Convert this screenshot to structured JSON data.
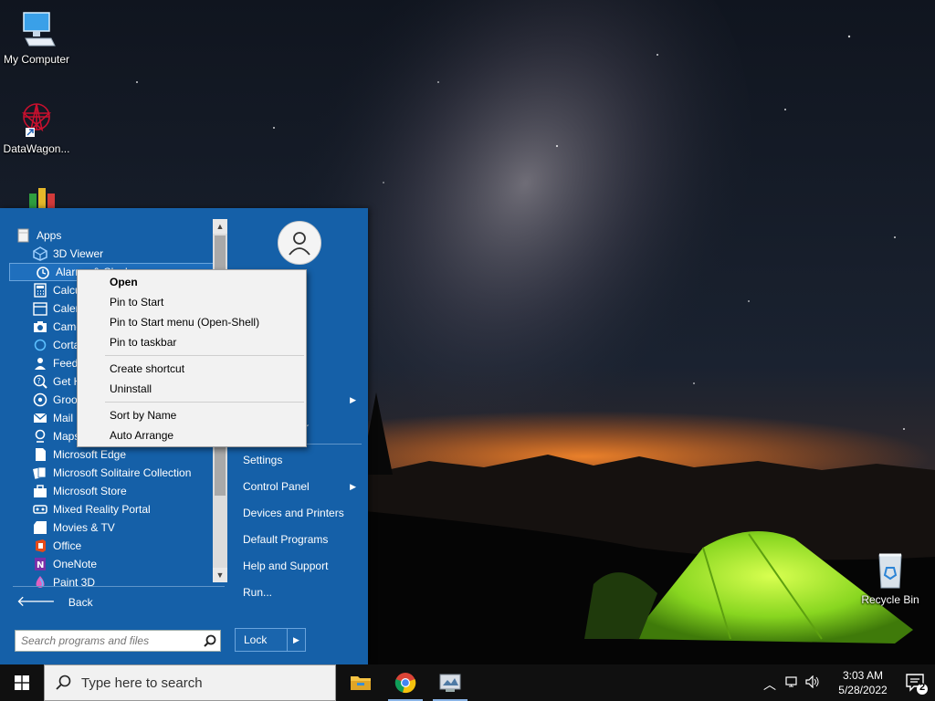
{
  "desktop": {
    "icons": [
      {
        "label": "My Computer"
      },
      {
        "label": "DataWagon..."
      },
      {
        "label": "Recycle Bin"
      }
    ]
  },
  "start_menu": {
    "folder": "Apps",
    "programs": [
      "3D Viewer",
      "Alarms & Clock",
      "Calculator",
      "Calendar",
      "Camera",
      "Cortana",
      "Feedback Hub",
      "Get Help",
      "Groove Music",
      "Mail",
      "Maps",
      "Microsoft Edge",
      "Microsoft Solitaire Collection",
      "Microsoft Store",
      "Mixed Reality Portal",
      "Movies & TV",
      "Office",
      "OneNote",
      "Paint 3D"
    ],
    "selected_program": "Alarms & Clock",
    "back_label": "Back",
    "search_placeholder": "Search programs and files",
    "right_items": {
      "settings": "Settings",
      "control_panel": "Control Panel",
      "devices_printers": "Devices and Printers",
      "default_programs": "Default Programs",
      "help_support": "Help and Support",
      "run": "Run..."
    },
    "lock_label": "Lock"
  },
  "context_menu": {
    "items": [
      "Open",
      "Pin to Start",
      "Pin to Start menu (Open-Shell)",
      "Pin to taskbar",
      "Create shortcut",
      "Uninstall",
      "Sort by Name",
      "Auto Arrange"
    ],
    "hidden_peeks": [
      "r"
    ]
  },
  "taskbar": {
    "search_placeholder": "Type here to search",
    "clock_time": "3:03 AM",
    "clock_date": "5/28/2022",
    "notification_count": "2"
  },
  "colors": {
    "start_menu_bg": "#1560a8",
    "taskbar_bg": "#101010",
    "context_bg": "#f2f2f2"
  }
}
